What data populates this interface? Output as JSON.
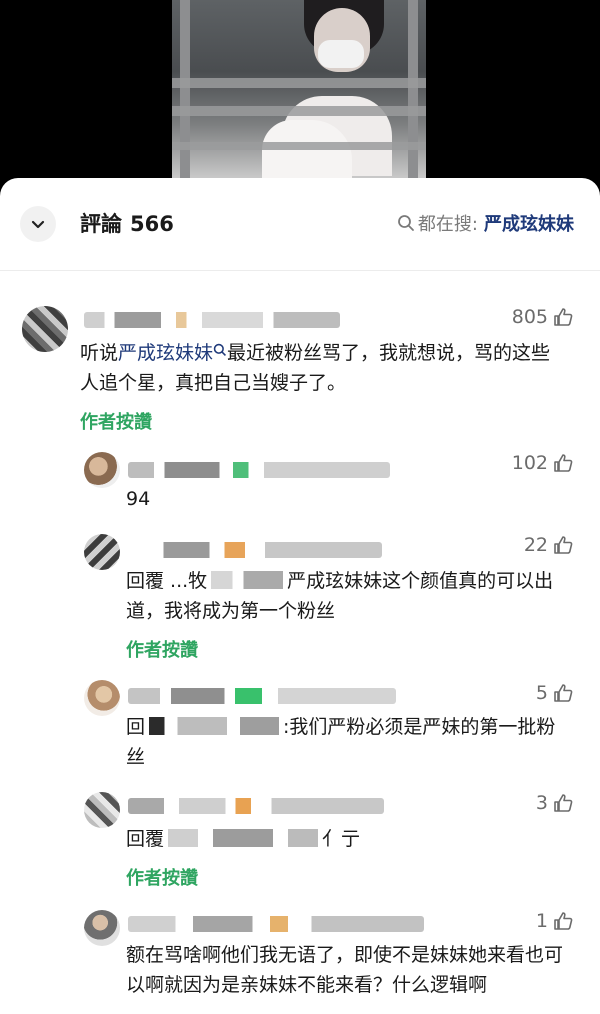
{
  "header": {
    "title": "評論",
    "count": "566",
    "search_prefix": "都在搜:",
    "search_keyword": "严成玹妹妹"
  },
  "comments": [
    {
      "likes": "805",
      "text_before": "听说",
      "link": "严成玹妹妹",
      "text_after": "最近被粉丝骂了，我就想说，骂的这些人追个星，真把自己当嫂子了。",
      "badge": "作者按讚"
    },
    {
      "likes": "102",
      "text": "94"
    },
    {
      "likes": "22",
      "text_before": "回覆 ...牧",
      "text_after": "严成玹妹妹这个颜值真的可以出道，我将成为第一个粉丝",
      "badge": "作者按讚"
    },
    {
      "likes": "5",
      "text_before": "回",
      "text_after": ":我们严粉必须是严妹的第一批粉丝"
    },
    {
      "likes": "3",
      "text_before": "回覆",
      "text_after": "亻亍",
      "badge": "作者按讚"
    },
    {
      "likes": "1",
      "text": "额在骂啥啊他们我无语了，即使不是妹妹她来看也可以啊就因为是亲妹妹不能来看？什么逻辑啊"
    }
  ],
  "icons": {
    "collapse": "chevron-down-icon",
    "search": "search-icon",
    "like": "thumbs-up-icon"
  },
  "colors": {
    "link": "#1f3a7a",
    "author_badge": "#2fa561"
  }
}
